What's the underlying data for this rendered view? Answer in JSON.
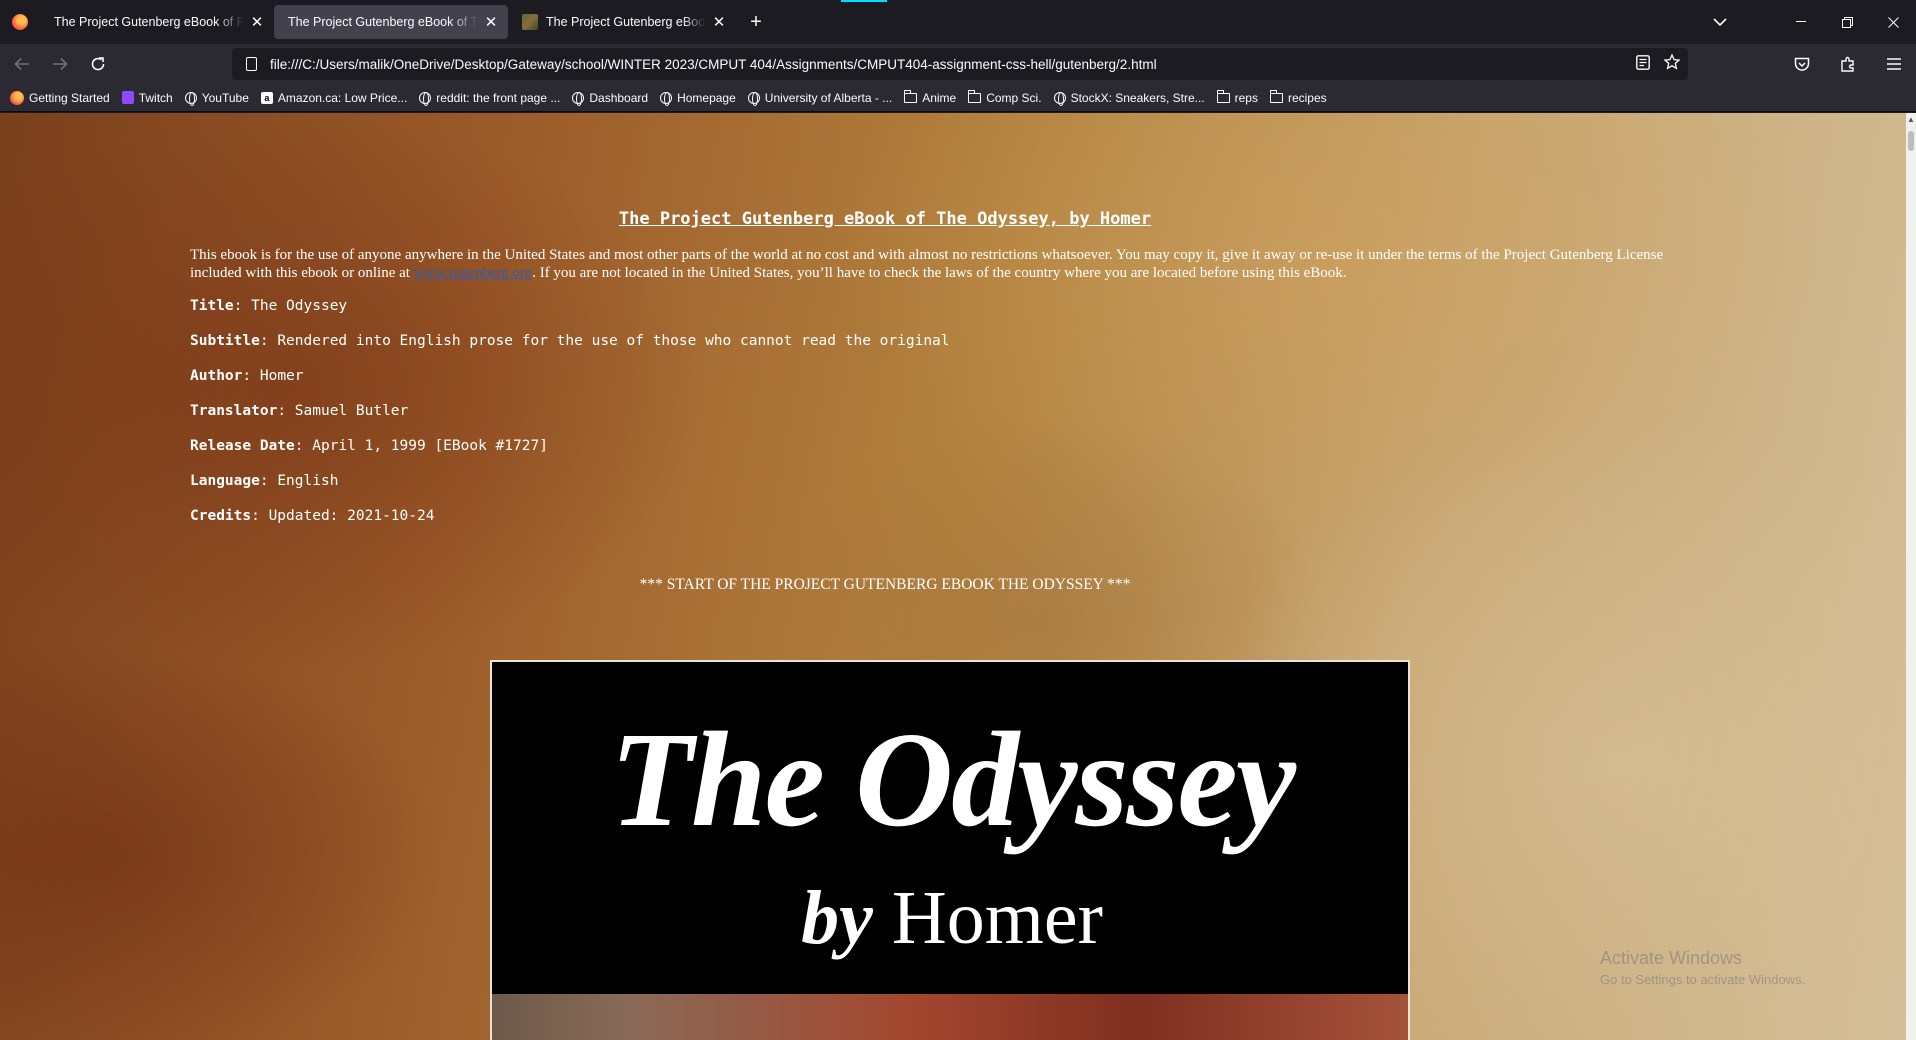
{
  "browser": {
    "tabs": [
      {
        "title": "The Project Gutenberg eBook of Peter Pan",
        "active": false,
        "has_favicon": false
      },
      {
        "title": "The Project Gutenberg eBook of The Odyssey",
        "active": true,
        "has_favicon": false
      },
      {
        "title": "The Project Gutenberg eBook of The Odyssey",
        "active": false,
        "has_favicon": true
      }
    ],
    "new_tab_icon": "plus-icon",
    "url": "file:///C:/Users/malik/OneDrive/Desktop/Gateway/school/WINTER 2023/CMPUT 404/Assignments/CMPUT404-assignment-css-hell/gutenberg/2.html",
    "bookmarks": [
      {
        "label": "Getting Started",
        "icon": "firefox"
      },
      {
        "label": "Twitch",
        "icon": "twitch"
      },
      {
        "label": "YouTube",
        "icon": "globe"
      },
      {
        "label": "Amazon.ca: Low Price...",
        "icon": "amazon"
      },
      {
        "label": "reddit: the front page ...",
        "icon": "globe"
      },
      {
        "label": "Dashboard",
        "icon": "globe"
      },
      {
        "label": "Homepage",
        "icon": "globe"
      },
      {
        "label": "University of Alberta - ...",
        "icon": "globe"
      },
      {
        "label": "Anime",
        "icon": "folder"
      },
      {
        "label": "Comp Sci.",
        "icon": "folder"
      },
      {
        "label": "StockX: Sneakers, Stre...",
        "icon": "globe"
      },
      {
        "label": "reps",
        "icon": "folder"
      },
      {
        "label": "recipes",
        "icon": "folder"
      }
    ]
  },
  "page": {
    "heading": "The Project Gutenberg eBook of The Odyssey, by Homer",
    "intro_before_link": "This ebook is for the use of anyone anywhere in the United States and most other parts of the world at no cost and with almost no restrictions whatsoever. You may copy it, give it away or re-use it under the terms of the Project Gutenberg License included with this ebook or online at ",
    "intro_link": "www.gutenberg.org",
    "intro_after_link": ". If you are not located in the United States, you’ll have to check the laws of the country where you are located before using this eBook.",
    "meta": [
      {
        "label": "Title",
        "value": "The Odyssey"
      },
      {
        "label": "Subtitle",
        "value": "Rendered into English prose for the use of those who cannot read the original"
      },
      {
        "label": "Author",
        "value": "Homer"
      },
      {
        "label": "Translator",
        "value": "Samuel Butler"
      },
      {
        "label": "Release Date",
        "value": "April 1, 1999 [EBook #1727]"
      },
      {
        "label": "Language",
        "value": "English"
      },
      {
        "label": "Credits",
        "value": "Updated: 2021-10-24"
      }
    ],
    "start_line": "*** START OF THE PROJECT GUTENBERG EBOOK THE ODYSSEY ***",
    "cover": {
      "title": "The Odyssey",
      "by": "by",
      "author": "Homer"
    }
  },
  "watermark": {
    "line1": "Activate Windows",
    "line2": "Go to Settings to activate Windows."
  }
}
